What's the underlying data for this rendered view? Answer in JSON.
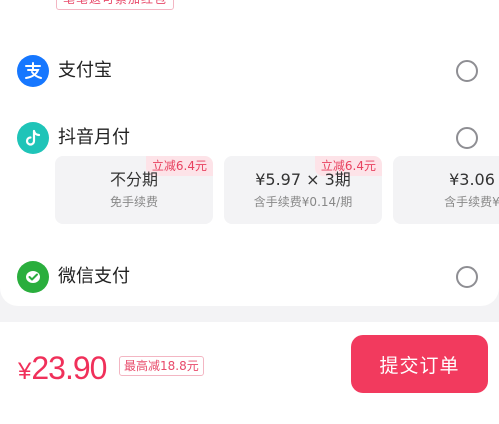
{
  "cashback_note": "笔笔返可累加红包",
  "methods": [
    {
      "label": "支付宝",
      "icon": "alipay-icon",
      "color": "#1677ff"
    },
    {
      "label": "抖音月付",
      "icon": "douyin-icon",
      "color": "#1fc4b8"
    },
    {
      "label": "微信支付",
      "icon": "wechat-pay-icon",
      "color": "#2aae3d"
    }
  ],
  "installment_plans": [
    {
      "badge": "立减6.4元",
      "main": "不分期",
      "sub": "免手续费"
    },
    {
      "badge": "立减6.4元",
      "main": "¥5.97 × 3期",
      "sub": "含手续费¥0.14/期"
    },
    {
      "badge": "",
      "main": "¥3.06",
      "sub": "含手续费¥"
    }
  ],
  "footer": {
    "currency": "¥",
    "amount": "23.90",
    "discount_tag": "最高减18.8元",
    "submit_label": "提交订单"
  },
  "colors": {
    "accent": "#f23a5e",
    "price": "#f0305a"
  }
}
